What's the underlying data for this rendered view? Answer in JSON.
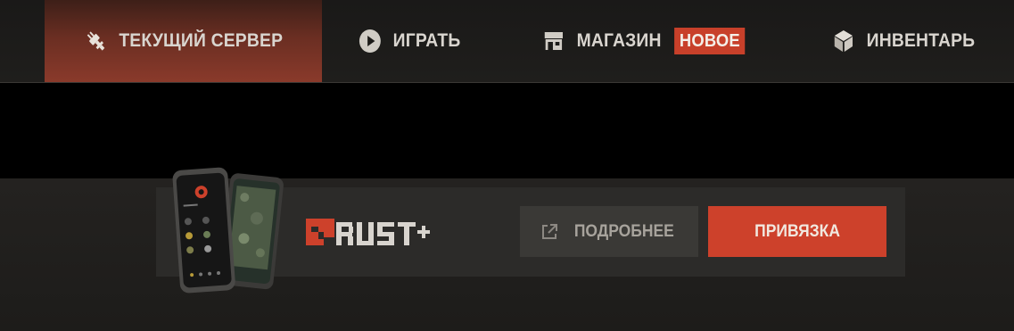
{
  "nav": {
    "tabs": [
      {
        "label": "ТЕКУЩИЙ СЕРВЕР",
        "icon": "plug-icon",
        "active": true
      },
      {
        "label": "ИГРАТЬ",
        "icon": "play-icon",
        "active": false
      },
      {
        "label": "МАГАЗИН",
        "icon": "store-icon",
        "active": false,
        "badge": "НОВОЕ"
      },
      {
        "label": "ИНВЕНТАРЬ",
        "icon": "box-icon",
        "active": false
      }
    ]
  },
  "promo": {
    "logo_text": "RUST+",
    "more_label": "ПОДРОБНЕЕ",
    "more_icon": "external-link-icon",
    "link_label": "ПРИВЯЗКА"
  },
  "colors": {
    "accent": "#cd412b",
    "active_tab": "#8a3a2b",
    "background": "#1c1b19"
  }
}
